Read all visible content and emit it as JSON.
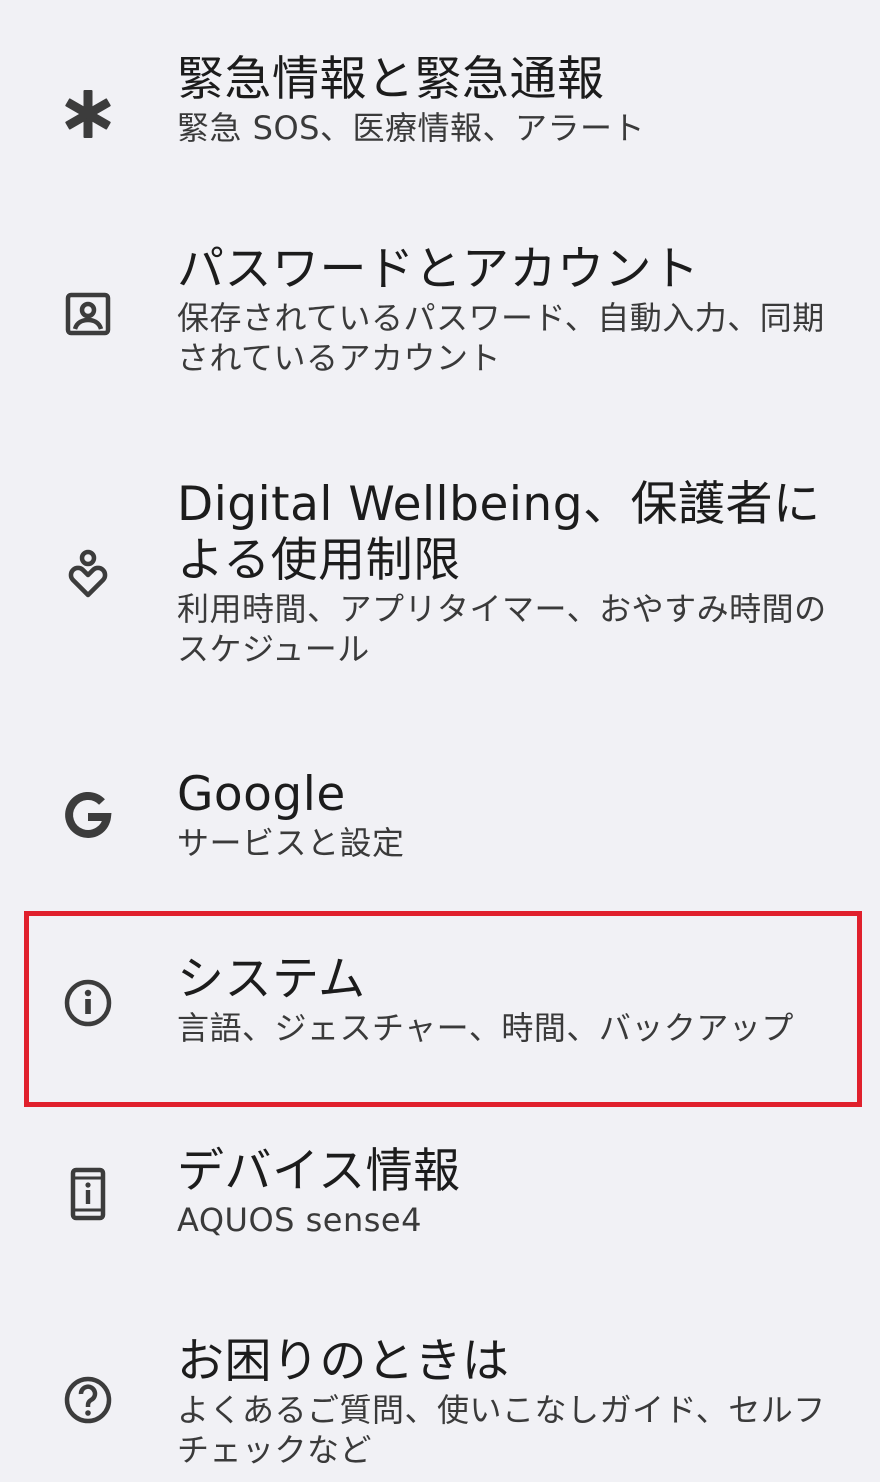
{
  "settings_items": [
    {
      "title": "緊急情報と緊急通報",
      "subtitle": "緊急 SOS、医療情報、アラート",
      "icon": "asterisk-icon"
    },
    {
      "title": "パスワードとアカウント",
      "subtitle": "保存されているパスワード、自動入力、同期されているアカウント",
      "icon": "account-box-icon"
    },
    {
      "title": "Digital Wellbeing、保護者による使用制限",
      "subtitle": "利用時間、アプリタイマー、おやすみ時間のスケジュール",
      "icon": "wellbeing-icon"
    },
    {
      "title": "Google",
      "subtitle": "サービスと設定",
      "icon": "google-g-icon"
    },
    {
      "title": "システム",
      "subtitle": "言語、ジェスチャー、時間、バックアップ",
      "icon": "info-icon"
    },
    {
      "title": "デバイス情報",
      "subtitle": "AQUOS sense4",
      "icon": "phone-info-icon"
    },
    {
      "title": "お困りのときは",
      "subtitle": "よくあるご質問、使いこなしガイド、セルフチェックなど",
      "icon": "help-icon"
    }
  ],
  "highlight_color": "#e0202c"
}
